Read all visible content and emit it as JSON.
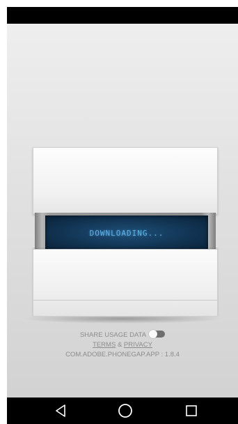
{
  "loader": {
    "status_text": "DOWNLOADING..."
  },
  "footer": {
    "share_label": "SHARE USAGE DATA",
    "share_enabled": false,
    "terms_label": "TERMS",
    "ampersand": "&",
    "privacy_label": "PRIVACY",
    "app_id": "COM.ADOBE.PHONEGAP.APP",
    "separator": ":",
    "version": "1.8.4"
  },
  "navigation": {
    "back_icon": "back-triangle-icon",
    "home_icon": "home-circle-icon",
    "recent_icon": "recent-apps-square-icon"
  },
  "colors": {
    "screen_text": "#5fb0e6",
    "status_bar": "#000000",
    "nav_bar": "#000000"
  }
}
